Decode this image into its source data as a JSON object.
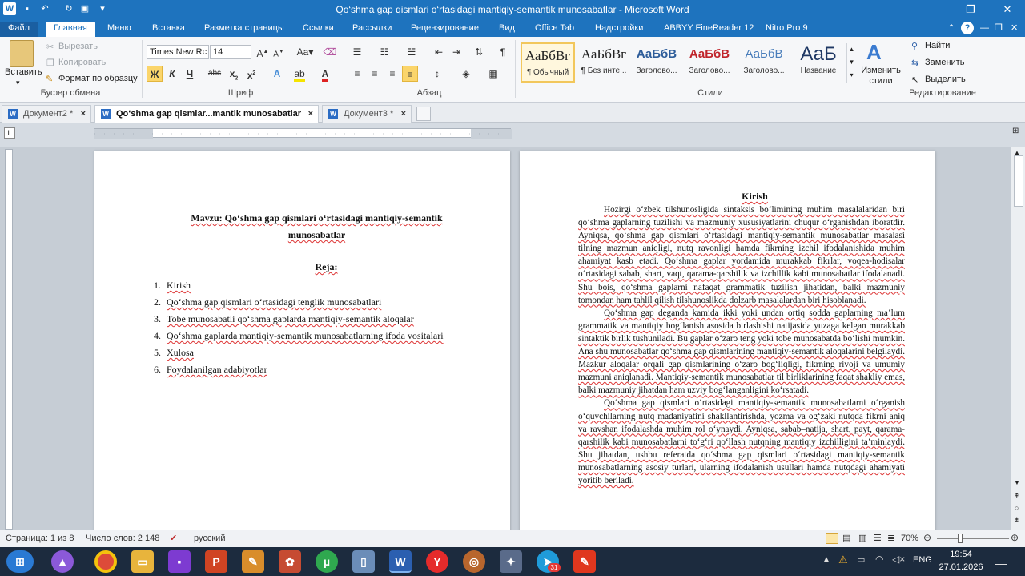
{
  "window": {
    "title": "Qo‘shma gap qismlari o‘rtasidagi mantiqiy-semantik munosabatlar  -  Microsoft Word",
    "controls": {
      "minimize": "—",
      "restore": "❐",
      "close": "✕"
    }
  },
  "ribbon_tabs": [
    "Файл",
    "Главная",
    "Меню",
    "Вставка",
    "Разметка страницы",
    "Ссылки",
    "Рассылки",
    "Рецензирование",
    "Вид",
    "Office Tab",
    "Надстройки",
    "ABBYY FineReader 12",
    "Nitro Pro 9"
  ],
  "ribbon": {
    "clipboard": {
      "paste": "Вставить",
      "cut": "Вырезать",
      "copy": "Копировать",
      "format_painter": "Формат по образцу",
      "label": "Буфер обмена"
    },
    "font": {
      "name": "Times New Rc",
      "size": "14",
      "label": "Шрифт"
    },
    "paragraph": {
      "label": "Абзац"
    },
    "styles": {
      "label": "Стили",
      "items": [
        {
          "preview": "АаБбВг",
          "name": "¶ Обычный",
          "color": "#000000"
        },
        {
          "preview": "АаБбВг",
          "name": "¶ Без инте...",
          "color": "#000000"
        },
        {
          "preview": "АаБбВ",
          "name": "Заголово...",
          "color": "#2e5d9a"
        },
        {
          "preview": "АаБбВ",
          "name": "Заголово...",
          "color": "#c0242b"
        },
        {
          "preview": "АаБбВ",
          "name": "Заголово...",
          "color": "#4a7ebb"
        },
        {
          "preview": "АаБ",
          "name": "Название",
          "color": "#1f3864"
        }
      ],
      "change": "Изменить стили"
    },
    "editing": {
      "find": "Найти",
      "replace": "Заменить",
      "select": "Выделить",
      "label": "Редактирование"
    }
  },
  "doc_tabs": [
    {
      "label": "Документ2 *"
    },
    {
      "label": "Qo‘shma gap qismlar...mantik munosabatlar"
    },
    {
      "label": "Документ3 *"
    }
  ],
  "page1": {
    "topic": "Mavzu: Qo‘shma gap qismlari o‘rtasidagi mantiqiy-semantik",
    "topic_line2": "munosabatlar",
    "plan_title": "Reja:",
    "plan": [
      "Kirish",
      "Qo‘shma gap qismlari o‘rtasidagi tenglik munosabatlari",
      "Tobe munosabatli qo‘shma gaplarda mantiqiy-semantik aloqalar",
      "Qo‘shma gaplarda mantiqiy-semantik munosabatlarning ifoda vositalari",
      "Xulosa",
      "Foydalanilgan adabiyotlar"
    ]
  },
  "page2": {
    "heading": "Kirish",
    "paragraphs": [
      "Hozirgi o‘zbek tilshunosligida sintaksis bo‘limining muhim masalalaridan biri qo‘shma gaplarning tuzilishi va mazmuniy xususiyatlarini chuqur o‘rganishdan iboratdir. Ayniqsa, qo‘shma gap qismlari o‘rtasidagi mantiqiy-semantik munosabatlar masalasi tilning mazmun aniqligi, nutq ravonligi hamda fikrning izchil ifodalanishida muhim ahamiyat kasb etadi. Qo‘shma gaplar yordamida murakkab fikrlar, voqea-hodisalar o‘rtasidagi sabab, shart, vaqt, qarama-qarshilik va izchillik kabi munosabatlar ifodalanadi. Shu bois, qo‘shma gaplarni nafaqat grammatik tuzilish jihatidan, balki mazmuniy tomondan ham tahlil qilish tilshunoslikda dolzarb masalalardan biri hisoblanadi.",
      "Qo‘shma gap deganda kamida ikki yoki undan ortiq sodda gaplarning ma’lum grammatik va mantiqiy bog‘lanish asosida birlashishi natijasida yuzaga kelgan murakkab sintaktik birlik tushuniladi. Bu gaplar o‘zaro teng yoki tobe munosabatda bo‘lishi mumkin. Ana shu munosabatlar qo‘shma gap qismlarining mantiqiy-semantik aloqalarini belgilaydi. Mazkur aloqalar orqali gap qismlarining o‘zaro bog‘liqligi, fikrning rivoji va umumiy mazmuni aniqlanadi. Mantiqiy-semantik munosabatlar til birliklarining faqat shakliy emas, balki mazmuniy jihatdan ham uzviy bog‘langanligini ko‘rsatadi.",
      "Qo‘shma gap qismlari o‘rtasidagi mantiqiy-semantik munosabatlarni o‘rganish o‘quvchilarning nutq madaniyatini shakllantirishda, yozma va og‘zaki nutqda fikrni aniq va ravshan ifodalashda muhim rol o‘ynaydi. Ayniqsa, sabab–natija, shart, payt, qarama-qarshilik kabi munosabatlarni to‘g‘ri qo‘llash nutqning mantiqiy izchilligini ta’minlaydi. Shu jihatdan, ushbu referatda qo‘shma gap qismlari o‘rtasidagi mantiqiy-semantik munosabatlarning asosiy turlari, ularning ifodalanish usullari hamda nutqdagi ahamiyati yoritib beriladi."
    ]
  },
  "status": {
    "page": "Страница: 1 из 8",
    "words": "Число слов: 2 148",
    "language": "русский",
    "zoom": "70%"
  },
  "taskbar": {
    "lang": "ENG",
    "time": "19:54",
    "date": "27.01.2026",
    "badge": "31"
  },
  "colors": {
    "accent": "#1e73be",
    "spell_error": "#dd3333",
    "taskbar": "#1c2b3e"
  }
}
